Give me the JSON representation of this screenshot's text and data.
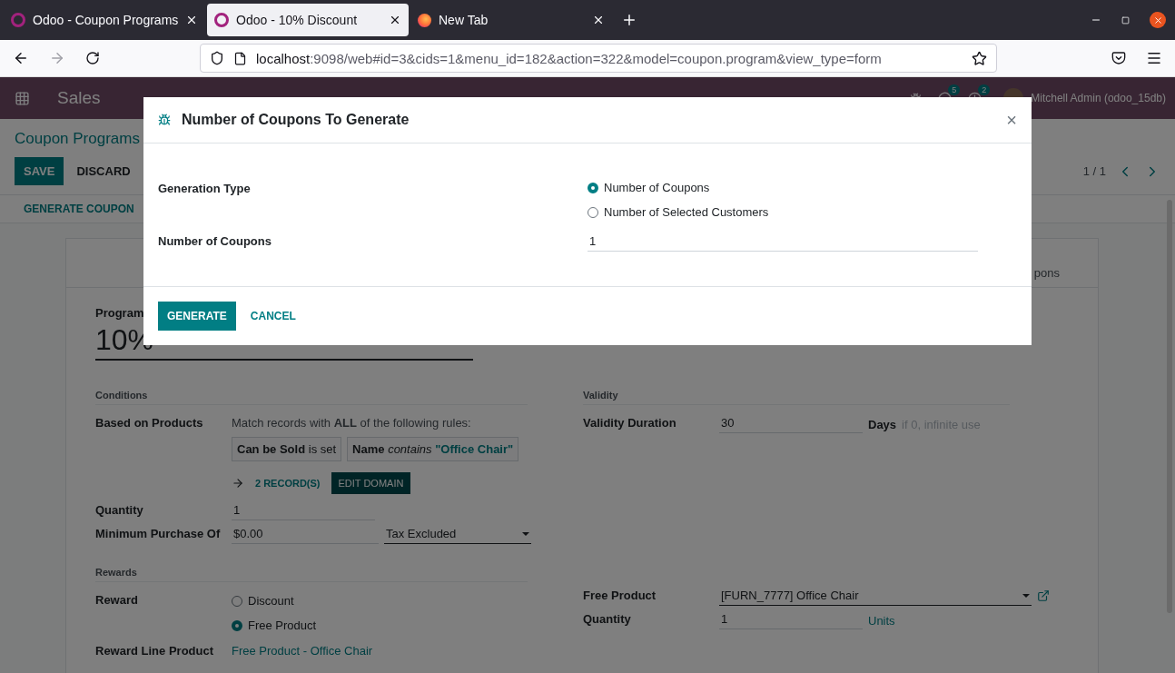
{
  "browser": {
    "tabs": [
      {
        "title": "Odoo - Coupon Programs",
        "selected": false,
        "kind": "odoo"
      },
      {
        "title": "Odoo - 10% Discount",
        "selected": true,
        "kind": "odoo"
      },
      {
        "title": "New Tab",
        "selected": false,
        "kind": "firefox"
      }
    ],
    "url": {
      "host": "localhost",
      "rest": ":9098/web#id=3&cids=1&menu_id=182&action=322&model=coupon.program&view_type=form"
    }
  },
  "app": {
    "name": "Sales",
    "messages_count": "5",
    "activities_count": "2",
    "user": "Mitchell Admin (odoo_15db)"
  },
  "control_panel": {
    "breadcrumb": "Coupon Programs",
    "buttons": [
      "SAVE",
      "DISCARD"
    ],
    "pager": "1 / 1",
    "action": "GENERATE COUPON"
  },
  "form": {
    "tab_fragment": "pons",
    "program_label": "Program",
    "program_name": "10%",
    "conditions": {
      "title": "Conditions",
      "based_label": "Based on Products",
      "rule_intro": "Match records with **ALL** of the following rules:",
      "rules": [
        {
          "field": "Can be Sold",
          "operator": "is set"
        },
        {
          "field": "Name",
          "operator": "contains",
          "value": "\"Office Chair\""
        }
      ],
      "records": "2 RECORD(S)",
      "edit_domain": "EDIT DOMAIN",
      "quantity_label": "Quantity",
      "quantity": "1",
      "min_label": "Minimum Purchase Of",
      "min_value": "$0.00",
      "tax": "Tax Excluded"
    },
    "validity": {
      "title": "Validity",
      "duration_label": "Validity Duration",
      "duration": "30",
      "unit": "Days",
      "hint": "if 0, infinite use"
    },
    "rewards": {
      "title": "Rewards",
      "reward_label": "Reward",
      "options": [
        {
          "label": "Discount",
          "selected": false
        },
        {
          "label": "Free Product",
          "selected": true
        }
      ],
      "free_product_label": "Free Product",
      "free_product": "[FURN_7777] Office Chair",
      "quantity_label": "Quantity",
      "quantity": "1",
      "unit": "Units",
      "line_label": "Reward Line Product",
      "line_value": "Free Product - Office Chair"
    }
  },
  "dialog": {
    "title": "Number of Coupons To Generate",
    "close": "×",
    "type_label": "Generation Type",
    "options": [
      {
        "label": "Number of Coupons",
        "selected": true
      },
      {
        "label": "Number of Selected Customers",
        "selected": false
      }
    ],
    "count_label": "Number of Coupons",
    "count": "1",
    "buttons": [
      "GENERATE",
      "CANCEL"
    ]
  }
}
